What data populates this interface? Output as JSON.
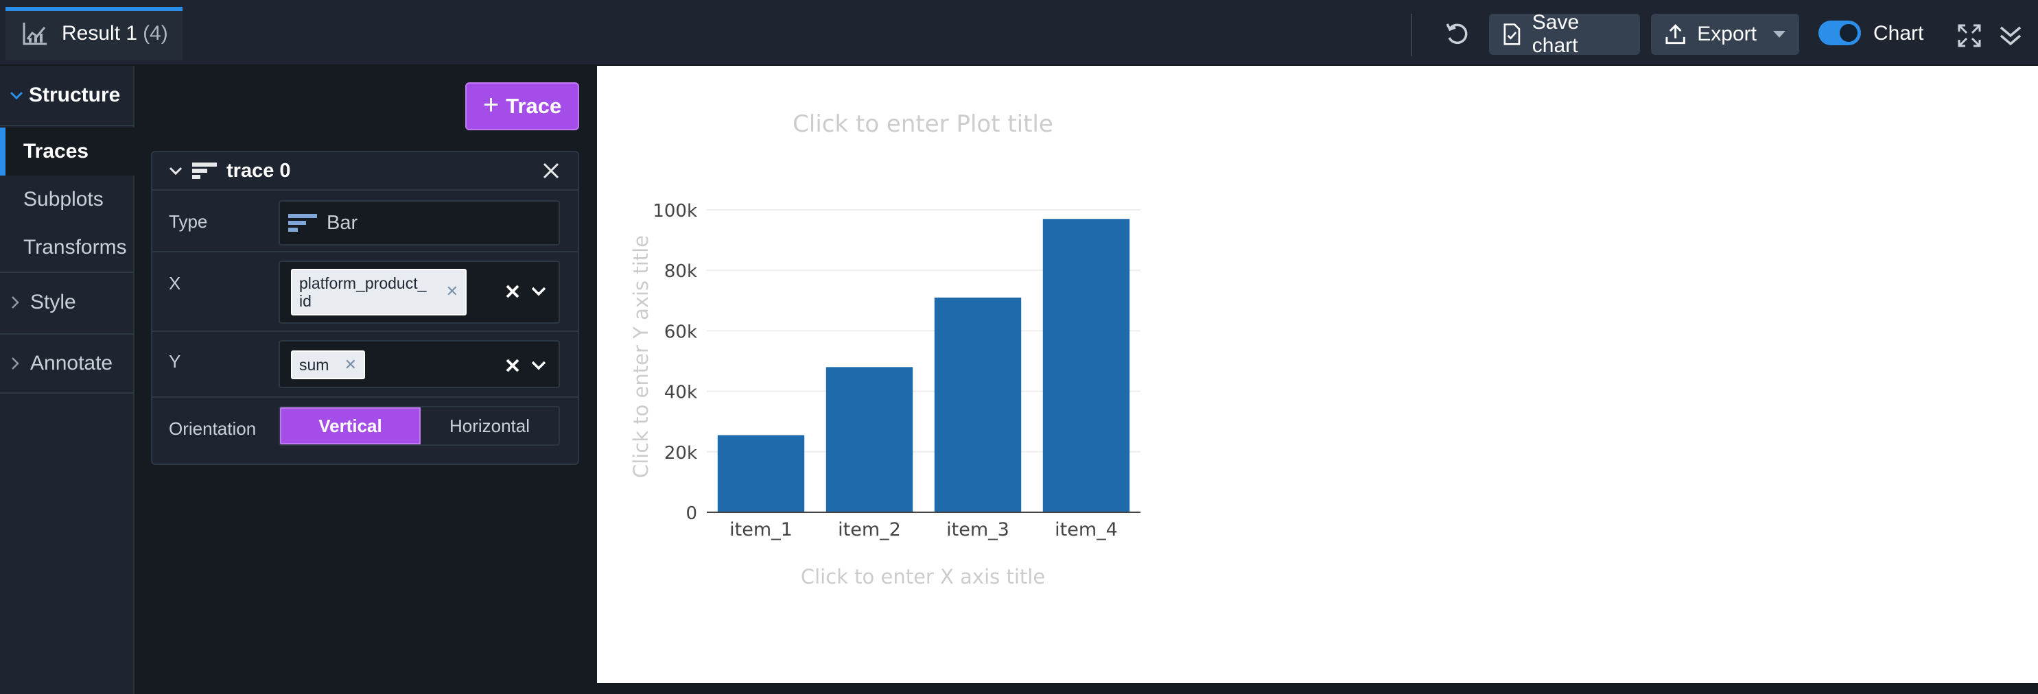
{
  "tab": {
    "title": "Result 1",
    "count": "(4)"
  },
  "toolbar": {
    "save_label": "Save chart",
    "export_label": "Export",
    "chart_toggle_label": "Chart"
  },
  "nav": {
    "structure": "Structure",
    "items": [
      {
        "label": "Traces",
        "active": true
      },
      {
        "label": "Subplots",
        "active": false
      },
      {
        "label": "Transforms",
        "active": false
      }
    ],
    "groups": [
      "Style",
      "Annotate"
    ]
  },
  "panel": {
    "add_trace_label": "Trace",
    "trace": {
      "name": "trace 0",
      "type_label": "Type",
      "type_value": "Bar",
      "x_label": "X",
      "x_chip_line1": "platform_product_",
      "x_chip_line2": "id",
      "y_label": "Y",
      "y_chip": "sum",
      "orientation_label": "Orientation",
      "orientation_options": [
        "Vertical",
        "Horizontal"
      ],
      "orientation_selected": "Vertical"
    }
  },
  "plot": {
    "title_placeholder": "Click to enter Plot title",
    "x_title_placeholder": "Click to enter X axis title",
    "y_title_placeholder": "Click to enter Y axis title"
  },
  "colors": {
    "accent": "#2b8ee8",
    "purple": "#a54de8",
    "bar": "#1f6aab"
  },
  "chart_data": {
    "type": "bar",
    "categories": [
      "item_1",
      "item_2",
      "item_3",
      "item_4"
    ],
    "values": [
      25500,
      48000,
      71000,
      97000
    ],
    "ylim": [
      0,
      100000
    ],
    "yticks": [
      0,
      20000,
      40000,
      60000,
      80000,
      100000
    ],
    "ytick_labels": [
      "0",
      "20k",
      "40k",
      "60k",
      "80k",
      "100k"
    ],
    "grid": true,
    "title": "",
    "xlabel": "",
    "ylabel": ""
  }
}
